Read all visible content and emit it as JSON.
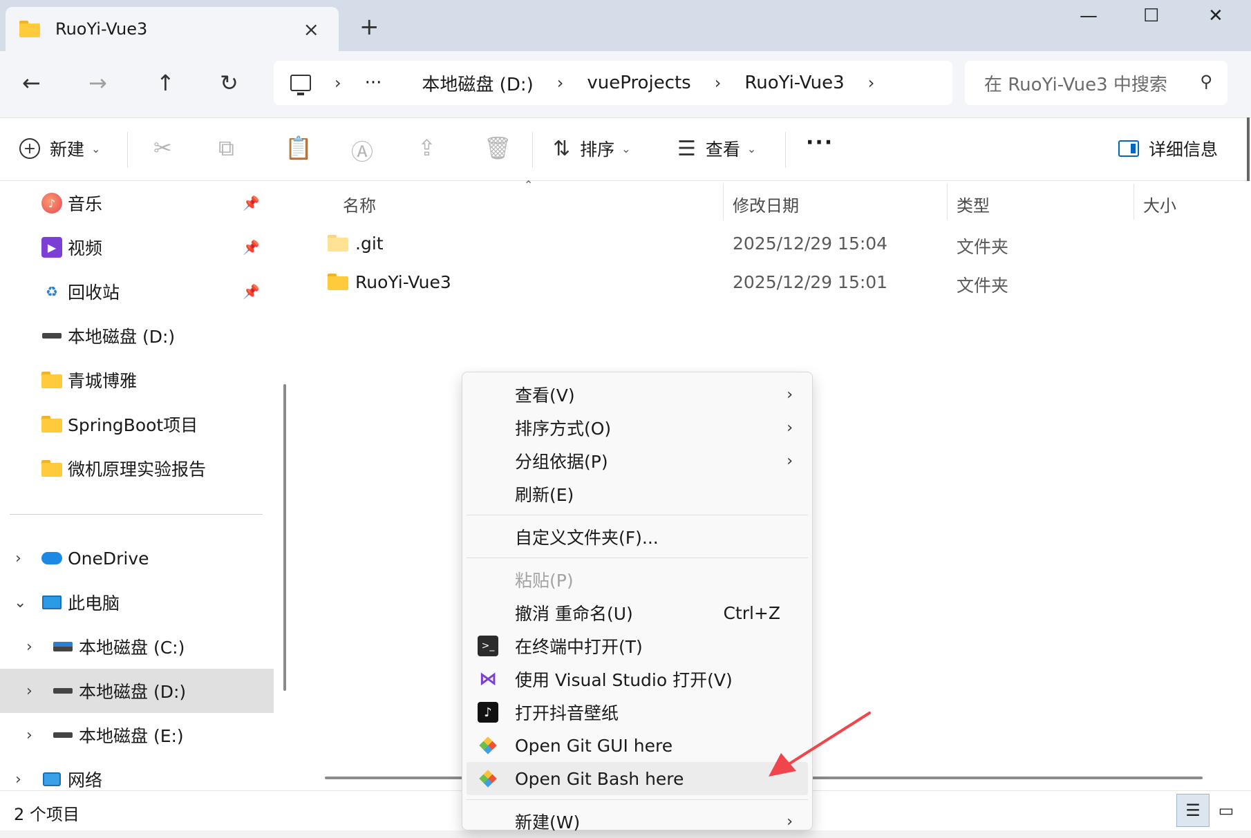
{
  "tab": {
    "title": "RuoYi-Vue3",
    "close_icon": "×",
    "new_tab_icon": "+"
  },
  "window_controls": {
    "minimize": "—",
    "maximize": "☐",
    "close": "✕"
  },
  "nav": {
    "back": "←",
    "forward": "→",
    "up": "↑",
    "refresh": "↻",
    "address": {
      "crumbs": [
        "本地磁盘 (D:)",
        "vueProjects",
        "RuoYi-Vue3"
      ],
      "ellipsis": "···"
    },
    "search_placeholder": "在 RuoYi-Vue3 中搜索"
  },
  "commandbar": {
    "new_label": "新建",
    "sort_label": "排序",
    "view_label": "查看",
    "more": "···",
    "details_label": "详细信息"
  },
  "sidebar": {
    "items": [
      {
        "label": "音乐",
        "icon": "music-icon",
        "pinned": true
      },
      {
        "label": "视频",
        "icon": "video-icon",
        "pinned": true
      },
      {
        "label": "回收站",
        "icon": "recycle-bin-icon",
        "pinned": true
      },
      {
        "label": "本地磁盘 (D:)",
        "icon": "drive-icon"
      },
      {
        "label": "青城博雅",
        "icon": "folder-icon"
      },
      {
        "label": "SpringBoot项目",
        "icon": "folder-icon"
      },
      {
        "label": "微机原理实验报告",
        "icon": "folder-icon"
      }
    ],
    "tree": [
      {
        "label": "OneDrive",
        "icon": "onedrive-icon"
      },
      {
        "label": "此电脑",
        "icon": "computer-icon"
      },
      {
        "label": "本地磁盘 (C:)",
        "icon": "windows-drive-icon"
      },
      {
        "label": "本地磁盘 (D:)",
        "icon": "drive-icon",
        "selected": true
      },
      {
        "label": "本地磁盘 (E:)",
        "icon": "drive-icon"
      },
      {
        "label": "网络",
        "icon": "network-icon"
      }
    ]
  },
  "filelist": {
    "columns": [
      "名称",
      "修改日期",
      "类型",
      "大小"
    ],
    "rows": [
      {
        "name": ".git",
        "date": "2025/12/29 15:04",
        "type": "文件夹"
      },
      {
        "name": "RuoYi-Vue3",
        "date": "2025/12/29 15:01",
        "type": "文件夹"
      }
    ]
  },
  "status": {
    "count": "2 个项目"
  },
  "context_menu": {
    "items": [
      {
        "label": "查看(V)",
        "submenu": true
      },
      {
        "label": "排序方式(O)",
        "submenu": true
      },
      {
        "label": "分组依据(P)",
        "submenu": true
      },
      {
        "label": "刷新(E)"
      },
      {
        "label": "自定义文件夹(F)..."
      },
      {
        "label": "粘贴(P)",
        "disabled": true
      },
      {
        "label": "撤消 重命名(U)",
        "shortcut": "Ctrl+Z"
      },
      {
        "label": "在终端中打开(T)",
        "icon": "terminal-icon"
      },
      {
        "label": "使用 Visual Studio 打开(V)",
        "icon": "visual-studio-icon"
      },
      {
        "label": "打开抖音壁纸",
        "icon": "douyin-icon"
      },
      {
        "label": "Open Git GUI here",
        "icon": "git-icon"
      },
      {
        "label": "Open Git Bash here",
        "icon": "git-icon",
        "hover": true
      },
      {
        "label": "新建(W)",
        "submenu": true
      }
    ],
    "arrow_glyph": "›"
  },
  "colors": {
    "accent": "#0067c0",
    "folder": "#ffcb3d",
    "annotation_arrow": "#f0454a"
  }
}
